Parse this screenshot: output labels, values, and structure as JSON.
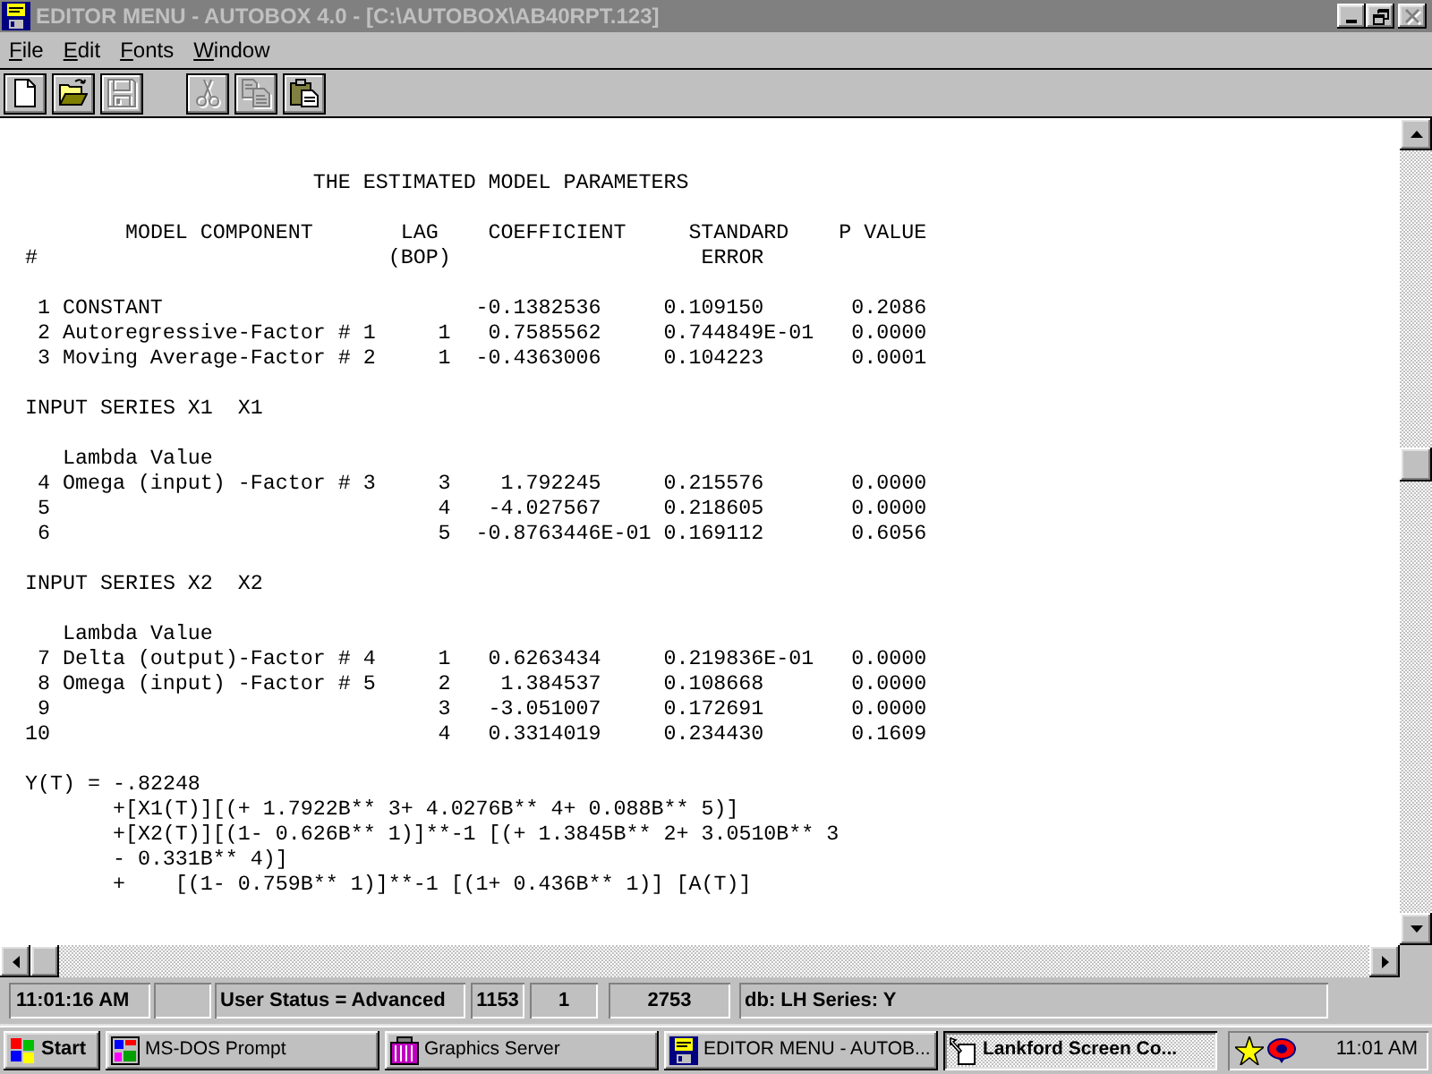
{
  "window": {
    "title": "EDITOR MENU - AUTOBOX 4.0 - [C:\\AUTOBOX\\AB40RPT.123]",
    "buttons": [
      {
        "kind": "minimize",
        "disabled": false
      },
      {
        "kind": "restore",
        "disabled": false
      },
      {
        "kind": "close",
        "disabled": true
      }
    ]
  },
  "menu": [
    {
      "key": "F",
      "rest": "ile"
    },
    {
      "key": "E",
      "rest": "dit"
    },
    {
      "key": "F",
      "rest": "onts"
    },
    {
      "key": "W",
      "rest": "indow"
    }
  ],
  "toolbar": {
    "groups": [
      [
        {
          "kind": "new",
          "disabled": false
        },
        {
          "kind": "open",
          "disabled": false
        },
        {
          "kind": "save",
          "disabled": true
        }
      ],
      [
        {
          "kind": "cut",
          "disabled": true
        },
        {
          "kind": "copy",
          "disabled": true
        },
        {
          "kind": "paste",
          "disabled": false
        }
      ]
    ]
  },
  "report": {
    "title": "THE ESTIMATED MODEL PARAMETERS",
    "columns": [
      {
        "label": "#"
      },
      {
        "label": "MODEL COMPONENT"
      },
      {
        "label": "LAG",
        "sublabel": "(BOP)"
      },
      {
        "label": "COEFFICIENT"
      },
      {
        "label": "STANDARD",
        "sublabel": "ERROR"
      },
      {
        "label": "P VALUE"
      }
    ],
    "groups": [
      {
        "rows": [
          {
            "index": "1",
            "component": "CONSTANT",
            "coefficient": "-0.1382536",
            "std_error": "0.109150",
            "p_value": "0.2086"
          },
          {
            "index": "2",
            "component": "Autoregressive-Factor # 1",
            "lag": "1",
            "coefficient": "0.7585562",
            "std_error": "0.744849E-01",
            "p_value": "0.0000"
          },
          {
            "index": "3",
            "component": "Moving Average-Factor # 2",
            "lag": "1",
            "coefficient": "-0.4363006",
            "std_error": "0.104223",
            "p_value": "0.0001"
          }
        ]
      },
      {
        "heading": "INPUT SERIES X1  X1",
        "subheading": "Lambda Value",
        "rows": [
          {
            "index": "4",
            "component": "Omega (input) -Factor # 3",
            "lag": "3",
            "coefficient": "1.792245",
            "std_error": "0.215576",
            "p_value": "0.0000"
          },
          {
            "index": "5",
            "lag": "4",
            "coefficient": "-4.027567",
            "std_error": "0.218605",
            "p_value": "0.0000"
          },
          {
            "index": "6",
            "lag": "5",
            "coefficient": "-0.8763446E-01",
            "std_error": "0.169112",
            "p_value": "0.6056"
          }
        ]
      },
      {
        "heading": "INPUT SERIES X2  X2",
        "subheading": "Lambda Value",
        "rows": [
          {
            "index": "7",
            "component": "Delta (output)-Factor # 4",
            "lag": "1",
            "coefficient": "0.6263434",
            "std_error": "0.219836E-01",
            "p_value": "0.0000"
          },
          {
            "index": "8",
            "component": "Omega (input) -Factor # 5",
            "lag": "2",
            "coefficient": "1.384537",
            "std_error": "0.108668",
            "p_value": "0.0000"
          },
          {
            "index": "9",
            "lag": "3",
            "coefficient": "-3.051007",
            "std_error": "0.172691",
            "p_value": "0.0000"
          },
          {
            "index": "10",
            "lag": "4",
            "coefficient": "0.3314019",
            "std_error": "0.234430",
            "p_value": "0.1609"
          }
        ]
      }
    ],
    "equation": {
      "lhs": "Y(T) = -.82248",
      "lines": [
        "+[X1(T)][(+ 1.7922B** 3+ 4.0276B** 4+ 0.088B** 5)]",
        "+[X2(T)][(1- 0.626B** 1)]**-1 [(+ 1.3845B** 2+ 3.0510B** 3",
        "- 0.331B** 4)]",
        "+    [(1- 0.759B** 1)]**-1 [(1+ 0.436B** 1)] [A(T)]"
      ]
    }
  },
  "status_bar": {
    "time": "11:01:16 AM",
    "user_status": "User Status = Advanced",
    "counters": [
      "1153",
      "1",
      "2753"
    ],
    "database": "db: LH Series: Y"
  },
  "taskbar": {
    "start": "Start",
    "tasks": [
      {
        "kind": "dos",
        "label": "MS-DOS Prompt",
        "selected": false
      },
      {
        "kind": "graphics",
        "label": "Graphics Server",
        "selected": false
      },
      {
        "kind": "editor",
        "label": "EDITOR MENU - AUTOB...",
        "selected": false
      },
      {
        "kind": "capture",
        "label": "Lankford Screen Co...",
        "selected": true
      }
    ],
    "clock": "11:01 AM"
  }
}
